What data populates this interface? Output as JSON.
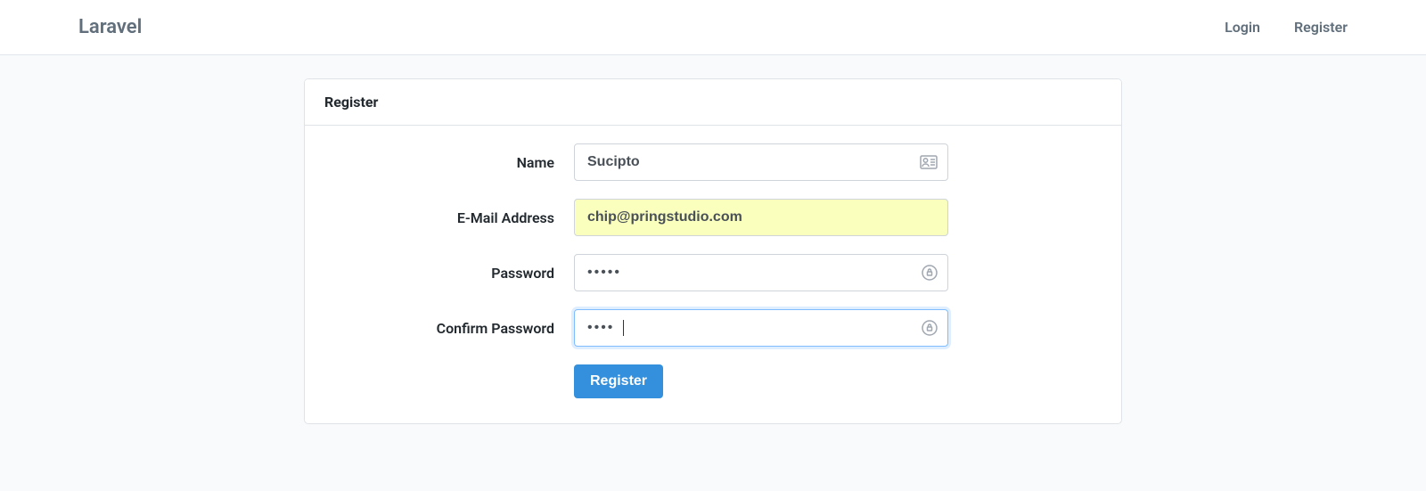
{
  "navbar": {
    "brand": "Laravel",
    "login": "Login",
    "register": "Register"
  },
  "card": {
    "header": "Register"
  },
  "form": {
    "name": {
      "label": "Name",
      "value": "Sucipto"
    },
    "email": {
      "label": "E-Mail Address",
      "value": "chip@pringstudio.com"
    },
    "password": {
      "label": "Password",
      "value": "•••••"
    },
    "confirm": {
      "label": "Confirm Password",
      "value": "••••"
    },
    "submit": "Register"
  }
}
